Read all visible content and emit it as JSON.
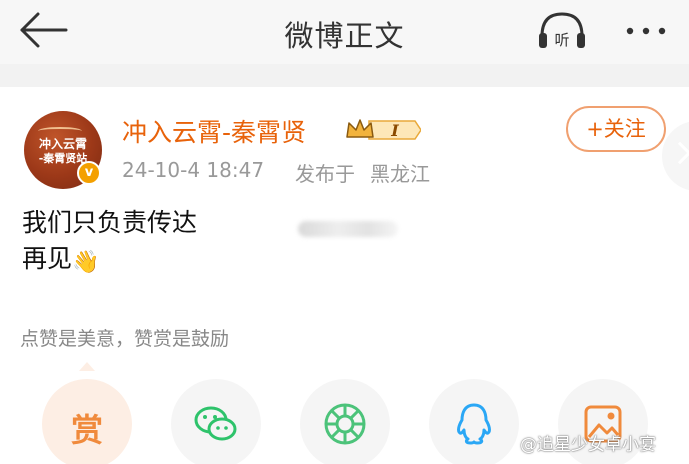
{
  "navbar": {
    "title": "微博正文",
    "listen_label": "听"
  },
  "post": {
    "author": {
      "name": "冲入云霄-秦霄贤",
      "avatar_line1": "冲入云霄",
      "avatar_line2": "-秦霄贤站",
      "verified_mark": "v",
      "vip_level": "I"
    },
    "time": "24-10-4 18:47",
    "location_prefix": "发布于",
    "location": "黑龙江",
    "follow_label": "+关注",
    "content_line1": "我们只负责传达",
    "content_line2": "再见",
    "content_emoji": "👋"
  },
  "reward_tip": "点赞是美意，赞赏是鼓励",
  "share": {
    "reward_label": "赏"
  },
  "watermark": "@追星少女卓小宴",
  "colors": {
    "accent": "#e8620a",
    "wechat": "#2ec36b",
    "moments": "#4cc37a",
    "qq": "#2aa7f5",
    "image_share": "#f08a3c"
  },
  "icons": [
    "back-arrow-icon",
    "listen-icon",
    "more-icon",
    "crown-icon",
    "wechat-icon",
    "moments-icon",
    "qq-icon",
    "image-share-icon",
    "chevron-icon"
  ]
}
